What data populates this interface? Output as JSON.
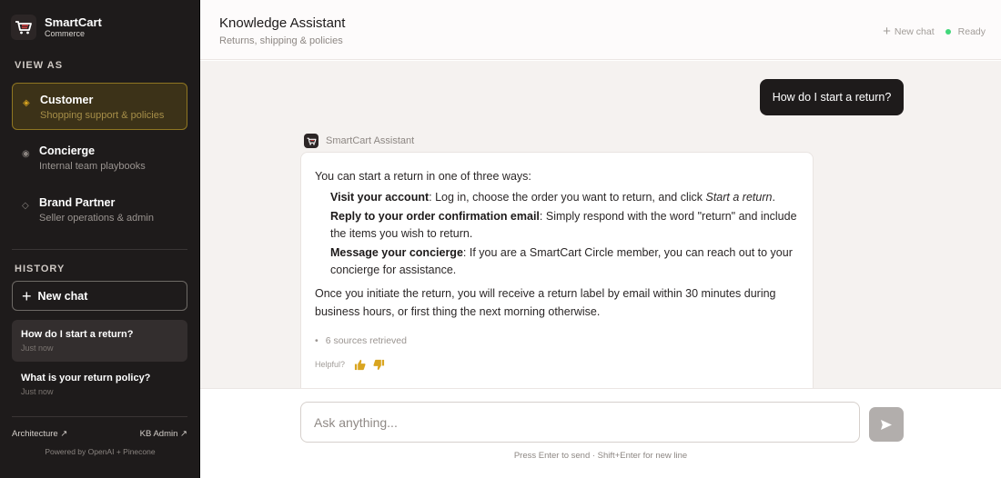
{
  "brand": {
    "name": "SmartCart",
    "subtitle": "Commerce"
  },
  "sidebar": {
    "view_as_label": "VIEW AS",
    "roles": [
      {
        "title": "Customer",
        "desc": "Shopping support & policies",
        "icon": "diamond-icon",
        "active": true
      },
      {
        "title": "Concierge",
        "desc": "Internal team playbooks",
        "icon": "circle-icon",
        "active": false
      },
      {
        "title": "Brand Partner",
        "desc": "Seller operations & admin",
        "icon": "diamond-outline-icon",
        "active": false
      }
    ],
    "history_label": "HISTORY",
    "new_chat_label": "New chat",
    "history": [
      {
        "title": "How do I start a return?",
        "time": "Just now",
        "active": true
      },
      {
        "title": "What is your return policy?",
        "time": "Just now",
        "active": false
      }
    ],
    "footer_links": {
      "architecture": "Architecture ↗",
      "kb_admin": "KB Admin ↗"
    },
    "powered_by": "Powered by OpenAI + Pinecone"
  },
  "header": {
    "title": "Knowledge Assistant",
    "subtitle": "Returns, shipping & policies",
    "new_chat_label": "New chat",
    "status": "Ready",
    "status_color": "#41d77a"
  },
  "chat": {
    "user_message": "How do I start a return?",
    "assistant_name": "SmartCart Assistant",
    "intro": "You can start a return in one of three ways:",
    "options": [
      {
        "key": "Visit your account",
        "text_before": ": Log in, choose the order you want to return, and click ",
        "emphasis": "Start a return",
        "text_after": "."
      },
      {
        "key": "Reply to your order confirmation email",
        "text": ": Simply respond with the word \"return\" and include the items you wish to return."
      },
      {
        "key": "Message your concierge",
        "text": ": If you are a SmartCart Circle member, you can reach out to your concierge for assistance."
      }
    ],
    "outro": "Once you initiate the return, you will receive a return label by email within 30 minutes during business hours, or first thing the next morning otherwise.",
    "sources": "6 sources retrieved",
    "helpful_label": "Helpful?"
  },
  "composer": {
    "placeholder": "Ask anything...",
    "hint": "Press Enter to send · Shift+Enter for new line"
  },
  "colors": {
    "sidebar_bg": "#1e1b1b",
    "accent_gold": "#d9a520",
    "send_disabled": "#b2aeac"
  }
}
